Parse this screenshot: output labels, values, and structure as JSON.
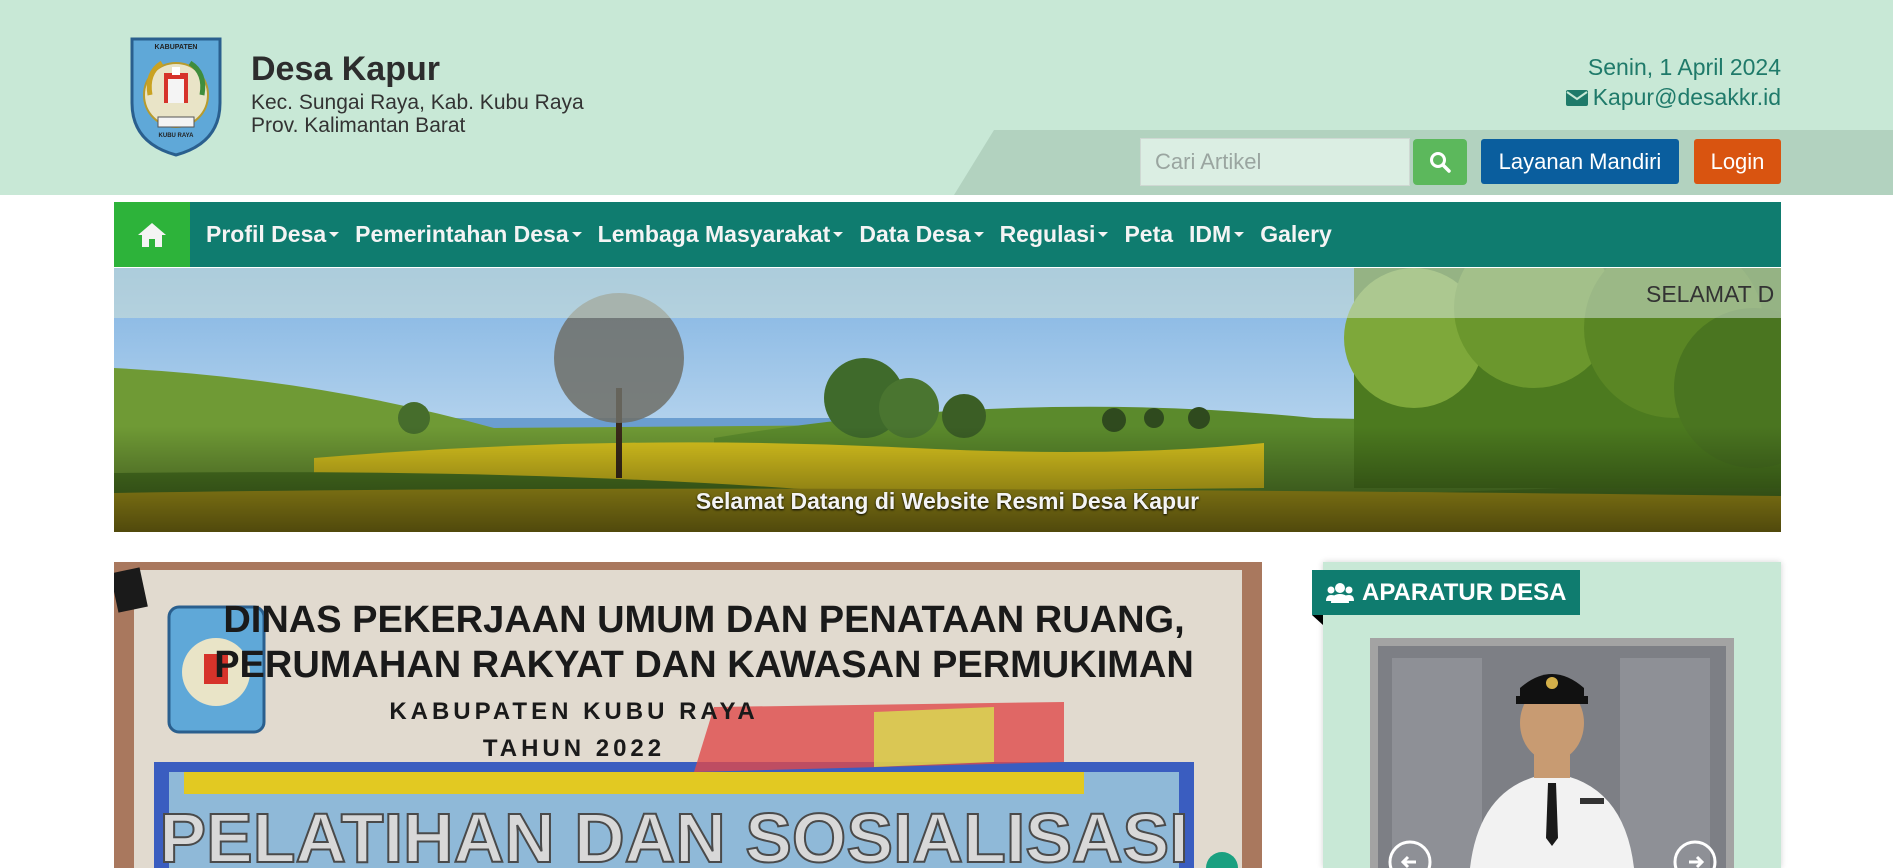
{
  "header": {
    "site_name": "Desa Kapur",
    "subtitle_line1": "Kec. Sungai Raya, Kab. Kubu Raya",
    "subtitle_line2": "Prov. Kalimantan Barat",
    "date": "Senin, 1 April 2024",
    "email": "Kapur@desakkr.id",
    "logo_text_top": "KABUPATEN",
    "logo_text_bottom": "KUBU RAYA"
  },
  "search": {
    "placeholder": "Cari Artikel",
    "value": ""
  },
  "buttons": {
    "layanan_mandiri": "Layanan Mandiri",
    "login": "Login"
  },
  "nav": {
    "items": [
      {
        "label": "Profil Desa",
        "dropdown": true
      },
      {
        "label": "Pemerintahan Desa",
        "dropdown": true
      },
      {
        "label": "Lembaga Masyarakat",
        "dropdown": true
      },
      {
        "label": "Data Desa",
        "dropdown": true
      },
      {
        "label": "Regulasi",
        "dropdown": true
      },
      {
        "label": "Peta",
        "dropdown": false
      },
      {
        "label": "IDM",
        "dropdown": true
      },
      {
        "label": "Galery",
        "dropdown": false
      }
    ]
  },
  "banner": {
    "ticker": "SELAMAT D",
    "caption": "Selamat Datang di Website Resmi Desa Kapur"
  },
  "article": {
    "banner_line1": "DINAS PEKERJAAN UMUM DAN PENATAAN RUANG,",
    "banner_line2": "PERUMAHAN RAKYAT DAN KAWASAN PERMUKIMAN",
    "banner_line3": "KABUPATEN KUBU RAYA",
    "banner_line4": "TAHUN 2022",
    "banner_line5": "PELATIHAN DAN SOSIALISASI"
  },
  "aparatur": {
    "title": "APARATUR DESA"
  },
  "colors": {
    "header_bg": "#c8e8d6",
    "nav_bg": "#0f7c6f",
    "home_bg": "#2db33a",
    "layanan_btn": "#0a5e9e",
    "login_btn": "#d95410",
    "search_btn": "#5cb85c",
    "accent_text": "#1f7a6a"
  }
}
